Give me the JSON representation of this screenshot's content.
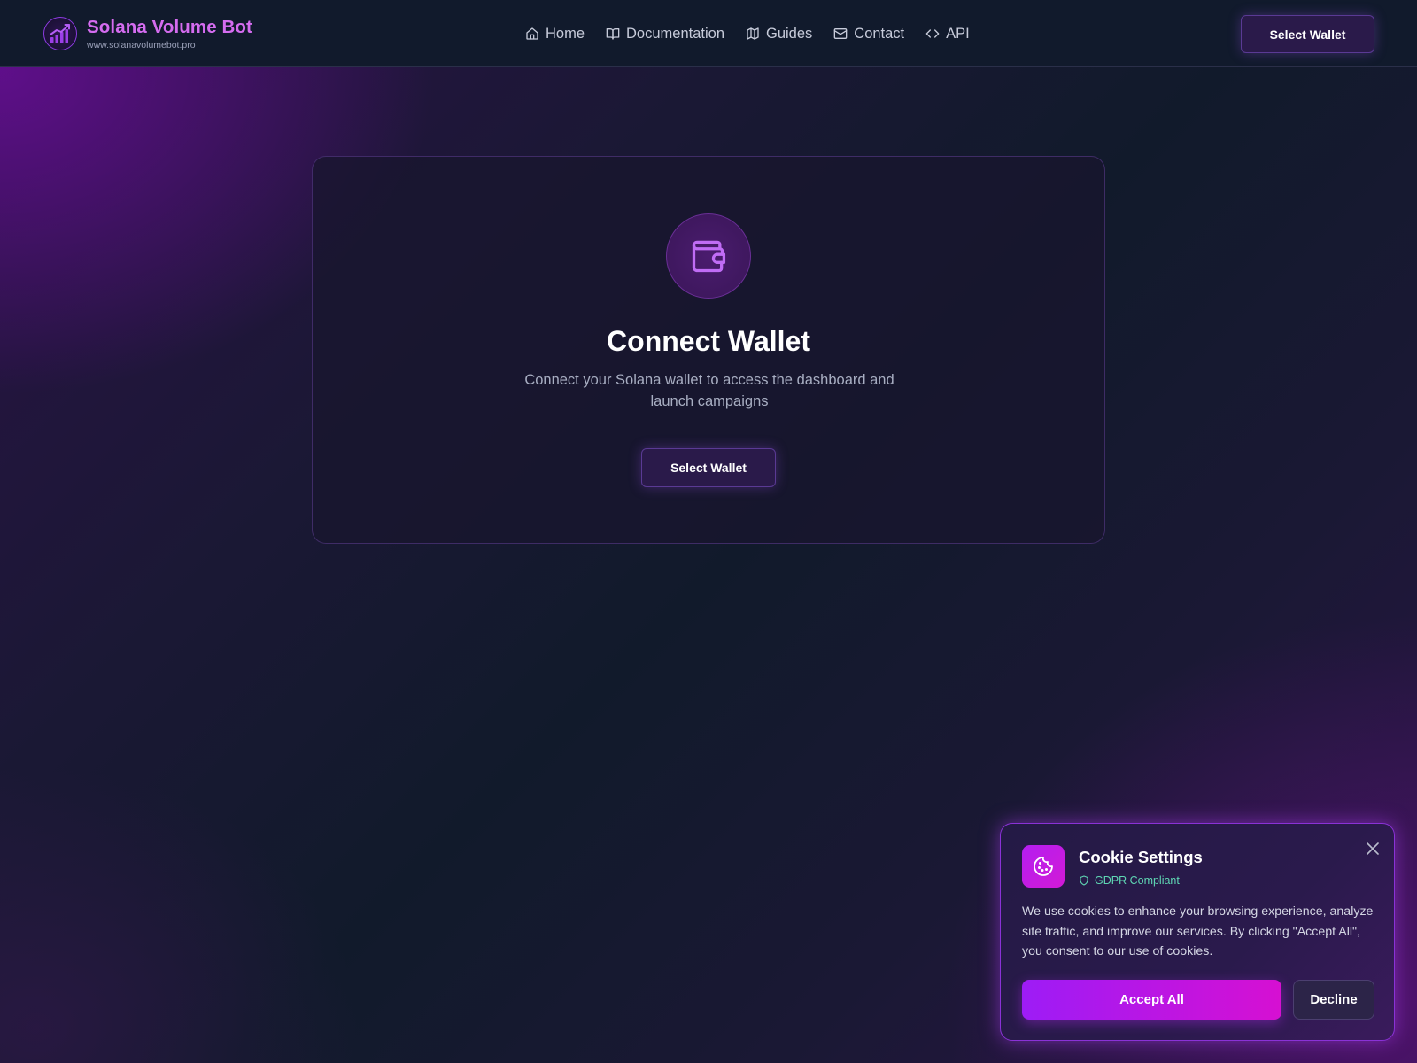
{
  "brand": {
    "title": "Solana Volume Bot",
    "url": "www.solanavolumebot.pro",
    "logo_icon": "chart-growth-icon",
    "accent_color": "#d56cf0"
  },
  "nav": {
    "items": [
      {
        "label": "Home",
        "icon": "home-icon"
      },
      {
        "label": "Documentation",
        "icon": "book-icon"
      },
      {
        "label": "Guides",
        "icon": "map-icon"
      },
      {
        "label": "Contact",
        "icon": "mail-icon"
      },
      {
        "label": "API",
        "icon": "code-icon"
      }
    ]
  },
  "header": {
    "wallet_button_label": "Select Wallet"
  },
  "card": {
    "icon": "wallet-icon",
    "title": "Connect Wallet",
    "description": "Connect your Solana wallet to access the dashboard and launch campaigns",
    "button_label": "Select Wallet"
  },
  "cookie": {
    "icon": "cookie-icon",
    "title": "Cookie Settings",
    "badge": "GDPR Compliant",
    "badge_color": "#5fd7b4",
    "text": "We use cookies to enhance your browsing experience, analyze site traffic, and improve our services. By clicking \"Accept All\", you consent to our use of cookies.",
    "accept_label": "Accept All",
    "decline_label": "Decline",
    "accept_gradient": [
      "#9d1cf6",
      "#d610d2"
    ]
  }
}
